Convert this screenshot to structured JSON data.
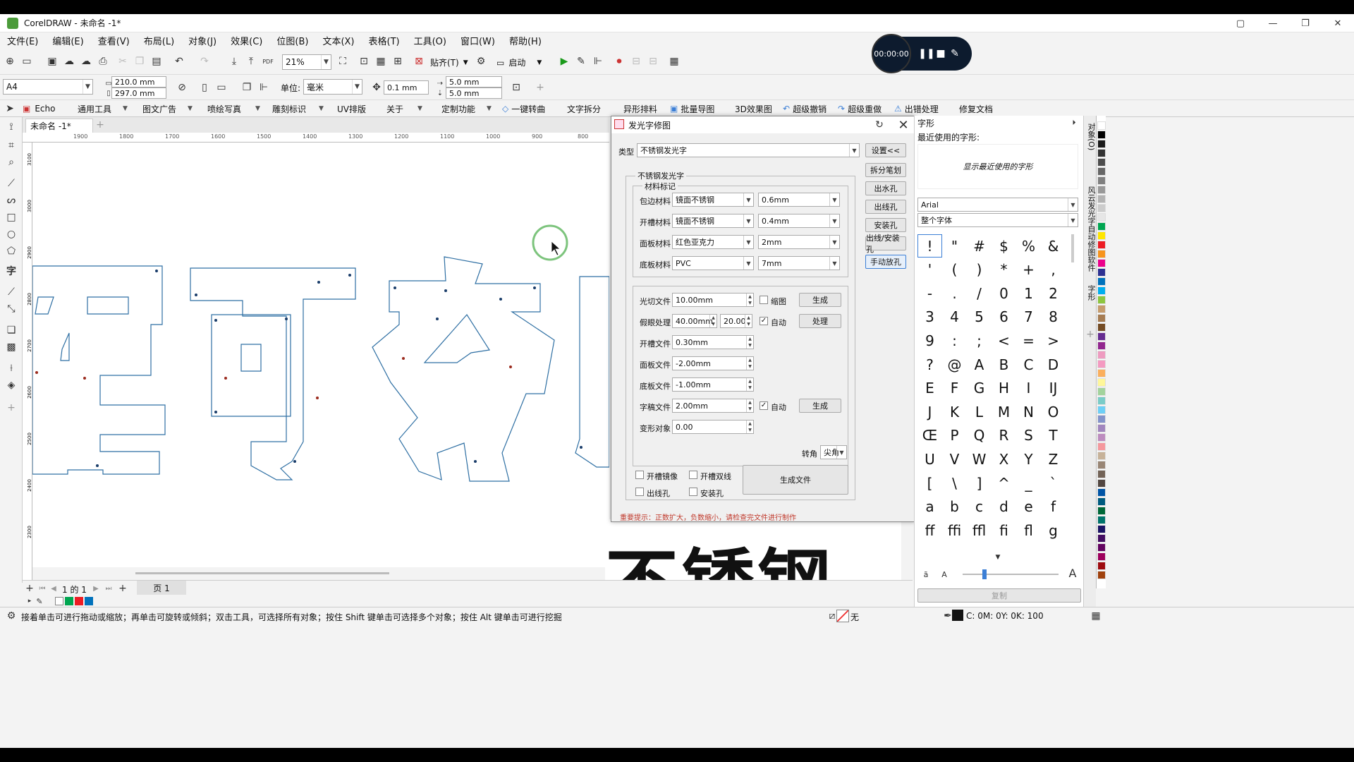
{
  "window": {
    "title": "CorelDRAW - 未命名 -1*",
    "controls": [
      "▢",
      "—",
      "❐",
      "✕"
    ]
  },
  "menu": [
    "文件(E)",
    "编辑(E)",
    "查看(V)",
    "布局(L)",
    "对象(J)",
    "效果(C)",
    "位图(B)",
    "文本(X)",
    "表格(T)",
    "工具(O)",
    "窗口(W)",
    "帮助(H)"
  ],
  "toolbar1": {
    "zoom": "21%",
    "snap": "贴齐(T)",
    "launch": "启动"
  },
  "toolbar2": {
    "page_size": "A4",
    "width": "210.0 mm",
    "height": "297.0 mm",
    "units_label": "单位:",
    "units": "毫米",
    "nudge": "0.1 mm",
    "dup_x": "5.0 mm",
    "dup_y": "5.0 mm"
  },
  "toolbar3": [
    "Echo",
    "通用工具",
    "图文广告",
    "喷绘写真",
    "雕刻标识",
    "UV排版",
    "关于",
    "定制功能",
    "一键转曲",
    "文字拆分",
    "异形排料",
    "批量导图",
    "3D效果图",
    "超级撤销",
    "超级重做",
    "出错处理",
    "修复文档"
  ],
  "document_tab": "未命名 -1*",
  "ruler_h": [
    "1900",
    "1800",
    "1700",
    "1600",
    "1500",
    "1400",
    "1300",
    "1200",
    "1100",
    "1000",
    "900",
    "800"
  ],
  "ruler_v": [
    "3100",
    "3000",
    "2900",
    "2800",
    "2700",
    "2600",
    "2500",
    "2400",
    "2300"
  ],
  "timer": {
    "time": "00:00:00"
  },
  "dialog": {
    "title": "发光字修图",
    "type_label": "类型",
    "type_value": "不锈钢发光字",
    "settings_btn": "设置<<",
    "group_title": "不锈钢发光字",
    "material_group": "材料标记",
    "materials": [
      {
        "label": "包边材料",
        "material": "镜面不锈钢",
        "thickness": "0.6mm"
      },
      {
        "label": "开槽材料",
        "material": "镜面不锈钢",
        "thickness": "0.4mm"
      },
      {
        "label": "面板材料",
        "material": "红色亚克力",
        "thickness": "2mm"
      },
      {
        "label": "底板材料",
        "material": "PVC",
        "thickness": "7mm"
      }
    ],
    "side_buttons": [
      "拆分笔划",
      "出水孔",
      "出线孔",
      "安装孔",
      "出线/安装孔",
      "手动放孔"
    ],
    "files": [
      {
        "label": "光切文件",
        "value": "10.00mm"
      },
      {
        "label": "假眼处理",
        "value": "40.00mm",
        "extra": "20.00"
      },
      {
        "label": "开槽文件",
        "value": "0.30mm"
      },
      {
        "label": "面板文件",
        "value": "-2.00mm"
      },
      {
        "label": "底板文件",
        "value": "-1.00mm"
      },
      {
        "label": "字稿文件",
        "value": "2.00mm"
      },
      {
        "label": "变形对象",
        "value": "0.00"
      }
    ],
    "shrink_label": "缩图",
    "auto_label": "自动",
    "generate_btn": "生成",
    "process_btn": "处理",
    "corner_label": "转角",
    "corner_value": "尖角",
    "checks": [
      "开槽镜像",
      "开槽双线",
      "出线孔",
      "安装孔"
    ],
    "generate_file_btn": "生成文件",
    "notice": "重要提示：正数扩大，负数缩小，请检查完文件进行制作"
  },
  "glyphs_panel": {
    "title": "字形",
    "recent_label": "最近使用的字形:",
    "recent_empty": "显示最近使用的字形",
    "font": "Arial",
    "subset": "整个字体",
    "copy_btn": "复制",
    "glyphs": [
      "!",
      "\"",
      "#",
      "$",
      "%",
      "&",
      "'",
      "(",
      ")",
      "*",
      "+",
      ",",
      "-",
      ".",
      "/",
      "0",
      "1",
      "2",
      "3",
      "4",
      "5",
      "6",
      "7",
      "8",
      "9",
      ":",
      ";",
      "<",
      "=",
      ">",
      "?",
      "@",
      "A",
      "B",
      "C",
      "D",
      "E",
      "F",
      "G",
      "H",
      "I",
      "IJ",
      "J",
      "K",
      "L",
      "M",
      "N",
      "O",
      "Œ",
      "P",
      "Q",
      "R",
      "S",
      "T",
      "U",
      "V",
      "W",
      "X",
      "Y",
      "Z",
      "[",
      "\\",
      "]",
      "^",
      "_",
      "`",
      "a",
      "b",
      "c",
      "d",
      "e",
      "f",
      "ff",
      "ffi",
      "ffl",
      "fi",
      "fl",
      "g"
    ]
  },
  "side_dock_tabs": [
    "对象(O)",
    "风云发光字自动修图软件",
    "字形"
  ],
  "page_nav": {
    "counter": "1 的 1",
    "page": "页 1"
  },
  "status": {
    "hint": "接着单击可进行拖动或缩放；再单击可旋转或倾斜；双击工具，可选择所有对象；按住 Shift 键单击可选择多个对象；按住 Alt 键单击可进行挖掘",
    "fill": "无",
    "color": "C: 0M: 0Y: 0K: 100"
  },
  "canvas_bottom_text": "不锈钢",
  "palette_colors": [
    "#ffffff",
    "#000000",
    "#1a1a1a",
    "#333333",
    "#4d4d4d",
    "#666666",
    "#808080",
    "#999999",
    "#b3b3b3",
    "#cccccc",
    "#e6e6e6",
    "#00a651",
    "#ffe600",
    "#ed1c24",
    "#f7941d",
    "#ec008c",
    "#2e3192",
    "#0072bc",
    "#00aeef",
    "#8dc63f",
    "#c69c6d",
    "#a67c52",
    "#754c24",
    "#662d91",
    "#92278f",
    "#ee9bc0",
    "#f49ac1",
    "#fbaf5d",
    "#fff799",
    "#a3d39c",
    "#7accc8",
    "#6dcff6",
    "#8393ca",
    "#a186be",
    "#bd8cbf",
    "#f5989d",
    "#c7b299",
    "#998675",
    "#736357",
    "#534741",
    "#0054a6",
    "#005b7f",
    "#006838",
    "#00746b",
    "#1b1464",
    "#440e62",
    "#630460",
    "#9e005d",
    "#9e0b0f",
    "#a0410d"
  ]
}
